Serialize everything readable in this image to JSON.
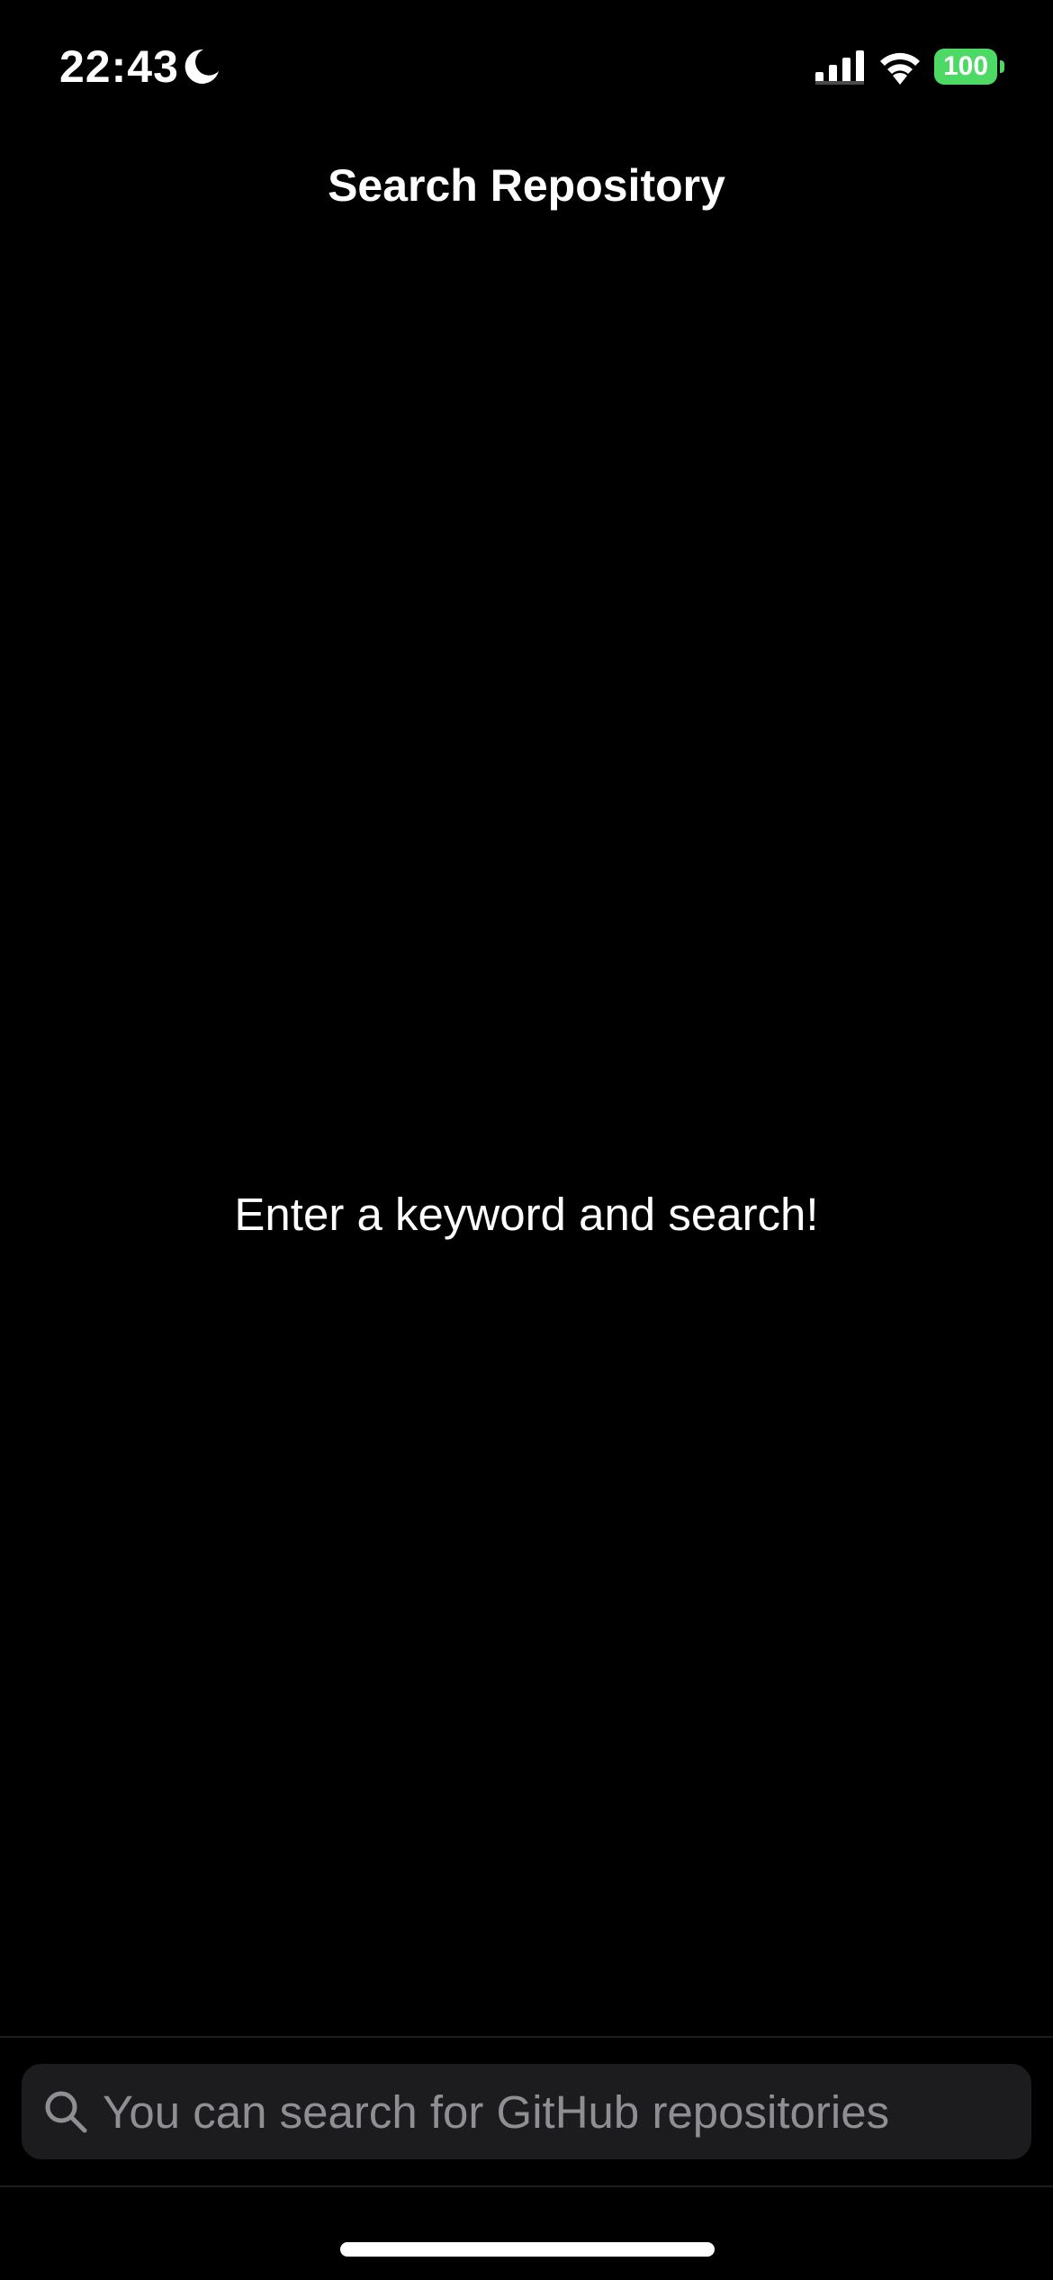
{
  "status_bar": {
    "time": "22:43",
    "battery_level": "100",
    "icons": [
      "moon-icon",
      "signal-icon",
      "wifi-icon",
      "battery-icon"
    ]
  },
  "navigation": {
    "title": "Search Repository"
  },
  "content": {
    "empty_message": "Enter a keyword and search!"
  },
  "search": {
    "placeholder": "You can search for GitHub repositories",
    "value": ""
  },
  "colors": {
    "background": "#000000",
    "text": "#ffffff",
    "search_field": "#1c1c1e",
    "placeholder": "#8e8e93",
    "battery": "#4cd964"
  }
}
